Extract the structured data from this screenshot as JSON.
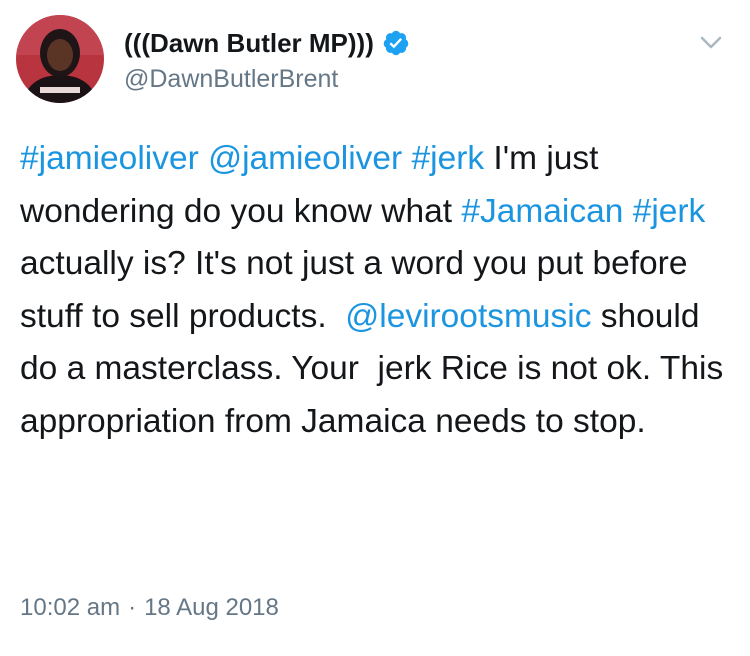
{
  "author": {
    "display_name": "(((Dawn Butler MP)))",
    "handle": "@DawnButlerBrent",
    "verified": true,
    "avatar_icon": "profile-photo"
  },
  "menu": {
    "icon": "chevron-down-icon"
  },
  "tweet": {
    "segments": [
      {
        "text": "#jamieoliver",
        "link": true
      },
      {
        "text": " ",
        "link": false
      },
      {
        "text": "@jamieoliver",
        "link": true
      },
      {
        "text": " ",
        "link": false
      },
      {
        "text": "#jerk",
        "link": true
      },
      {
        "text": " I'm just wondering do you know what ",
        "link": false
      },
      {
        "text": "#Jamaican",
        "link": true
      },
      {
        "text": " ",
        "link": false
      },
      {
        "text": "#jerk",
        "link": true
      },
      {
        "text": " actually is? It's not just a word you put before stuff to sell products.  ",
        "link": false
      },
      {
        "text": "@levirootsmusic",
        "link": true
      },
      {
        "text": " should do a masterclass. Your  jerk Rice is not ok. This appropriation from Jamaica needs to stop.",
        "link": false
      }
    ]
  },
  "meta": {
    "time": "10:02 am",
    "separator": "·",
    "date": "18 Aug 2018"
  },
  "colors": {
    "link": "#1b95e0",
    "text": "#14171a",
    "muted": "#657786",
    "verified": "#1da1f2"
  }
}
